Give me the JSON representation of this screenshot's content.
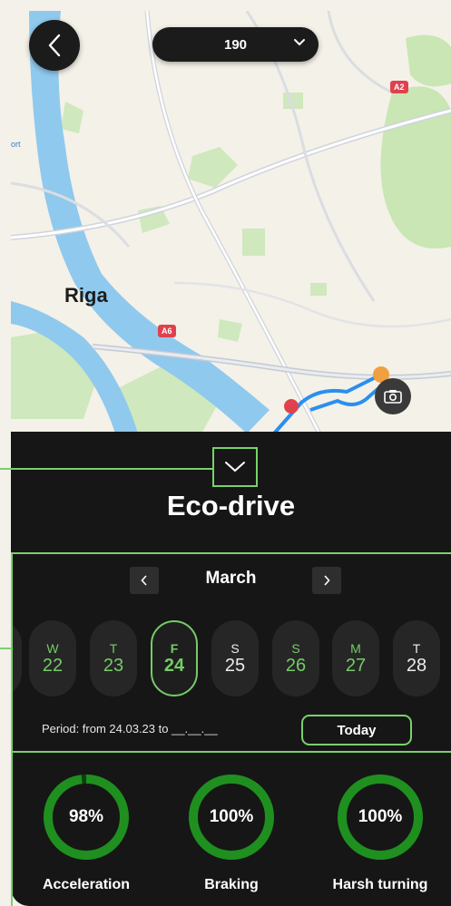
{
  "map": {
    "city": "Riga",
    "partial_label": "ort",
    "shields": [
      "A2",
      "A6"
    ]
  },
  "header": {
    "vehicle": "190"
  },
  "panel": {
    "title": "Eco-drive",
    "month": "March",
    "days": [
      {
        "weekday": "W",
        "day": "22",
        "state": "green"
      },
      {
        "weekday": "T",
        "day": "23",
        "state": "green"
      },
      {
        "weekday": "F",
        "day": "24",
        "state": "selected"
      },
      {
        "weekday": "S",
        "day": "25",
        "state": "white"
      },
      {
        "weekday": "S",
        "day": "26",
        "state": "green"
      },
      {
        "weekday": "M",
        "day": "27",
        "state": "green"
      },
      {
        "weekday": "T",
        "day": "28",
        "state": "white"
      }
    ],
    "period": "Period: from 24.03.23 to __.__.__",
    "today_label": "Today",
    "metrics": [
      {
        "value": "98%",
        "label": "Acceleration",
        "level": 0.98
      },
      {
        "value": "100%",
        "label": "Braking",
        "level": 1.0
      },
      {
        "value": "100%",
        "label": "Harsh turning",
        "level": 1.0
      }
    ]
  },
  "colors": {
    "accent": "#78d26a",
    "ring": "#1f8f1f",
    "panel_bg": "#161616"
  },
  "icons": [
    "back-chevron-icon",
    "chevron-down-icon",
    "camera-icon",
    "speed-marker-icon",
    "vehicle-marker-icon"
  ]
}
